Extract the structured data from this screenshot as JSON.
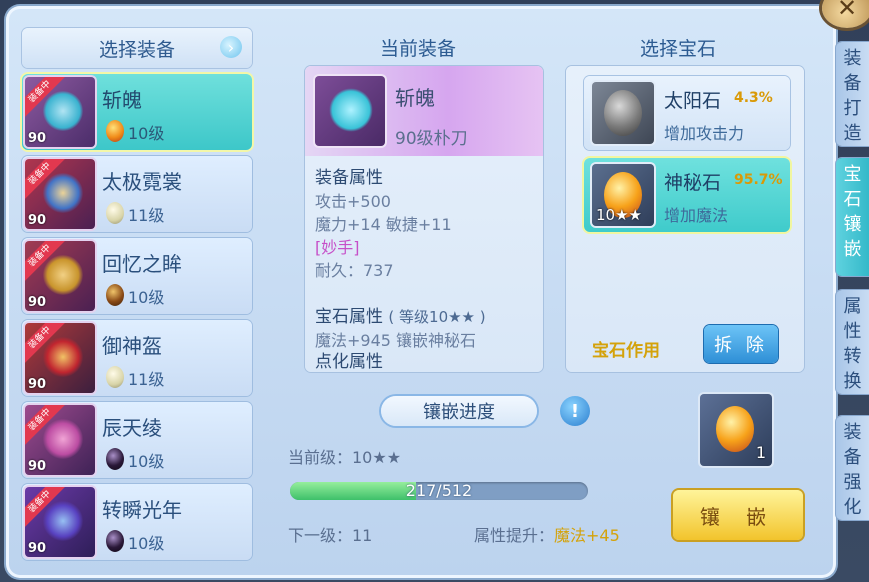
{
  "left": {
    "title": "选择装备",
    "equipped_tag": "装备中",
    "items": [
      {
        "name": "斩魄",
        "level": "90",
        "gem_level": "10级",
        "gem": "orange"
      },
      {
        "name": "太极霓裳",
        "level": "90",
        "gem_level": "11级",
        "gem": "pearl"
      },
      {
        "name": "回忆之眸",
        "level": "90",
        "gem_level": "10级",
        "gem": "brown"
      },
      {
        "name": "御神盔",
        "level": "90",
        "gem_level": "11级",
        "gem": "pearl"
      },
      {
        "name": "辰天绫",
        "level": "90",
        "gem_level": "10级",
        "gem": "dark"
      },
      {
        "name": "转瞬光年",
        "level": "90",
        "gem_level": "10级",
        "gem": "dark"
      }
    ]
  },
  "current": {
    "title": "当前装备",
    "name": "斩魄",
    "subtitle": "90级朴刀",
    "attr_head": "装备属性",
    "attr_lines": [
      "攻击+500",
      "魔力+14 敏捷+11"
    ],
    "special": "[妙手]",
    "durability": "耐久：737",
    "gem_head": "宝石属性",
    "gem_level": "( 等级10★★ )",
    "gem_line": "魔法+945 镶嵌神秘石",
    "cut_line": "点化属性"
  },
  "gems": {
    "title": "选择宝石",
    "items": [
      {
        "name": "太阳石",
        "pct": "4.3%",
        "desc": "增加攻击力",
        "count": ""
      },
      {
        "name": "神秘石",
        "pct": "95.7%",
        "desc": "增加魔法",
        "count": "10★★"
      }
    ],
    "effect_label": "宝石作用",
    "remove_label": "拆 除"
  },
  "progress": {
    "title": "镶嵌进度",
    "info": "!",
    "current_level": "当前级：10★★",
    "value": "217/512",
    "fraction": 0.424,
    "next_level": "下一级：11",
    "boost_label": "属性提升：",
    "boost_value": "魔法+45",
    "slot_count": "1",
    "inlay_label": "镶 嵌"
  },
  "tabs": [
    "装备打造",
    "宝石镶嵌",
    "属性转换",
    "装备强化"
  ],
  "colors": {
    "accent": "#3dc7c9",
    "gold": "#d99a08",
    "pink": "#c64fc8"
  }
}
